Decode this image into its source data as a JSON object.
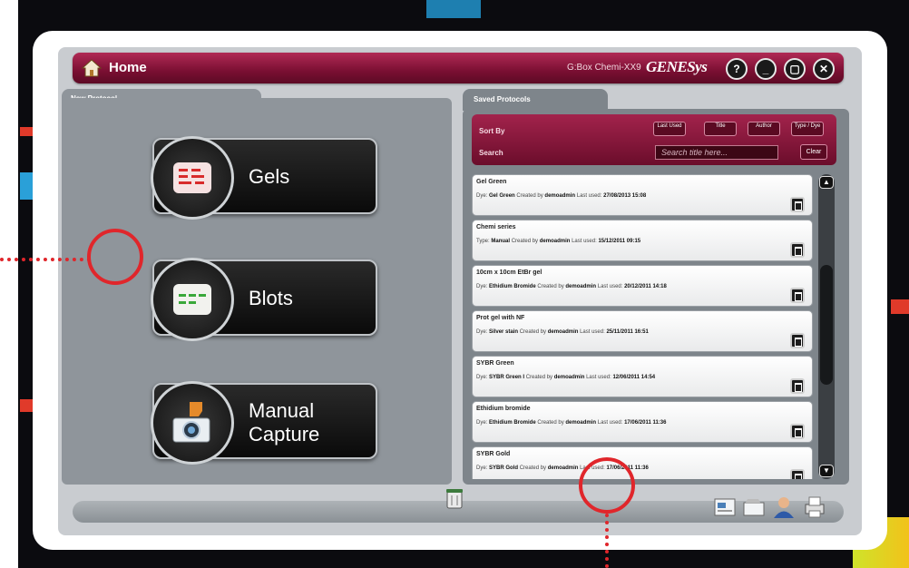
{
  "app": {
    "title": "Home",
    "device": "G:Box Chemi-XX9",
    "brand": "GENESys",
    "window_buttons": [
      "?",
      "_",
      "▢",
      "✕"
    ]
  },
  "new_protocol": {
    "tab_label": "New Protocol",
    "buttons": [
      {
        "label": "Gels",
        "icon": "gels-icon"
      },
      {
        "label": "Blots",
        "icon": "blots-icon"
      },
      {
        "label": "Manual\nCapture",
        "icon": "camera-icon"
      }
    ]
  },
  "saved_protocols": {
    "tab_label": "Saved Protocols",
    "sort_label": "Sort By",
    "sort_buttons": [
      "Last Used",
      "Title",
      "Author",
      "Type / Dye"
    ],
    "search_label": "Search",
    "search_placeholder": "Search title here...",
    "clear_label": "Clear",
    "items": [
      {
        "name": "Gel Green",
        "type_label": "Dye:",
        "type": "Gel Green",
        "created_label": "Created by",
        "author": "demoadmin",
        "used_label": "Last used:",
        "last_used": "27/08/2013 15:08"
      },
      {
        "name": "Chemi series",
        "type_label": "Type:",
        "type": "Manual",
        "created_label": "Created by",
        "author": "demoadmin",
        "used_label": "Last used:",
        "last_used": "15/12/2011 09:15"
      },
      {
        "name": "10cm x 10cm EtBr gel",
        "type_label": "Dye:",
        "type": "Ethidium Bromide",
        "created_label": "Created by",
        "author": "demoadmin",
        "used_label": "Last used:",
        "last_used": "20/12/2011 14:18"
      },
      {
        "name": "Prot gel with NF",
        "type_label": "Dye:",
        "type": "Silver stain",
        "created_label": "Created by",
        "author": "demoadmin",
        "used_label": "Last used:",
        "last_used": "25/11/2011 16:51"
      },
      {
        "name": "SYBR Green",
        "type_label": "Dye:",
        "type": "SYBR Green I",
        "created_label": "Created by",
        "author": "demoadmin",
        "used_label": "Last used:",
        "last_used": "12/06/2011 14:54"
      },
      {
        "name": "Ethidium bromide",
        "type_label": "Dye:",
        "type": "Ethidium Bromide",
        "created_label": "Created by",
        "author": "demoadmin",
        "used_label": "Last used:",
        "last_used": "17/06/2011 11:36"
      },
      {
        "name": "SYBR Gold",
        "type_label": "Dye:",
        "type": "SYBR Gold",
        "created_label": "Created by",
        "author": "demoadmin",
        "used_label": "Last used:",
        "last_used": "17/06/2011 11:36"
      }
    ]
  },
  "colors": {
    "accent": "#8a1238",
    "callout": "#e0262b"
  }
}
